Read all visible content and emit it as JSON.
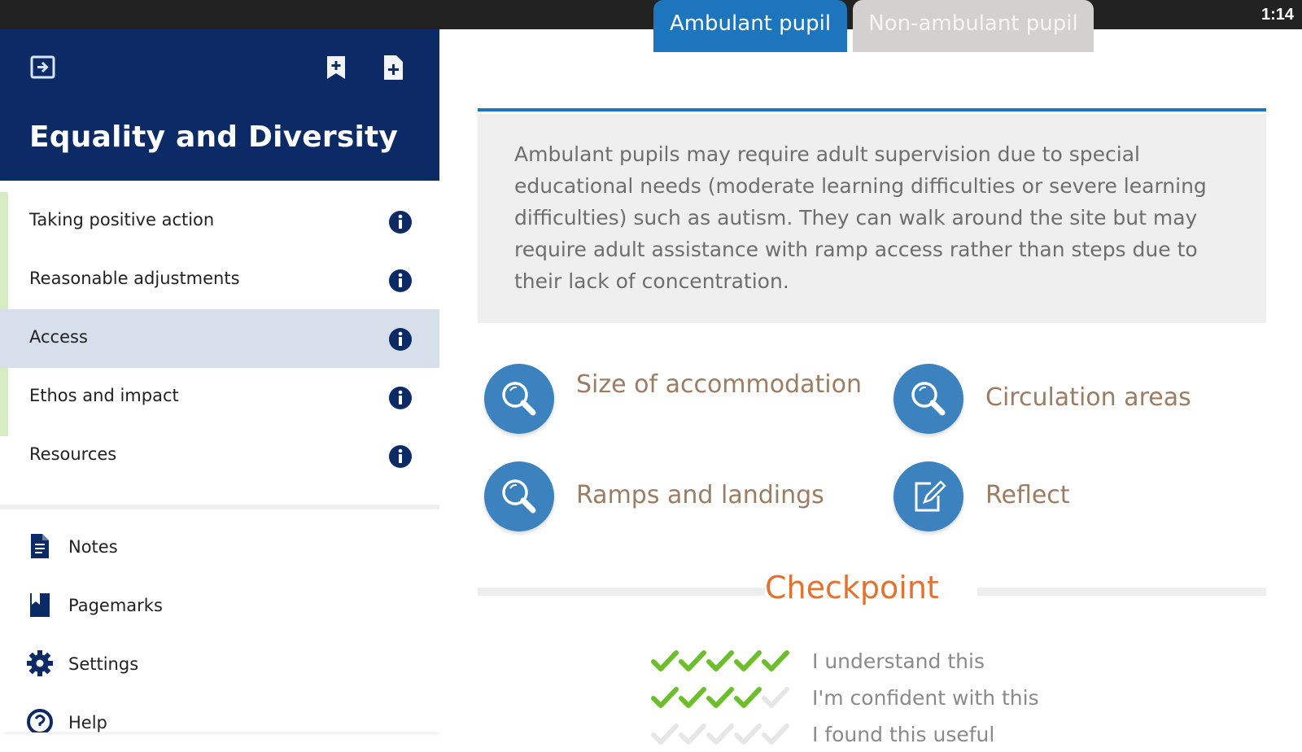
{
  "status_bar": {
    "time": "1:14"
  },
  "sidebar": {
    "title": "Equality and Diversity",
    "header_icons": [
      "exit-icon",
      "add-bookmark-icon",
      "add-note-icon"
    ],
    "menu_items": [
      {
        "label": "Taking positive action",
        "active": false
      },
      {
        "label": "Reasonable adjustments",
        "active": false
      },
      {
        "label": "Access",
        "active": true
      },
      {
        "label": "Ethos and impact",
        "active": false
      },
      {
        "label": "Resources",
        "active": false
      }
    ],
    "nav_items": [
      {
        "label": "Notes",
        "icon": "notes-icon"
      },
      {
        "label": "Pagemarks",
        "icon": "pagemarks-icon"
      },
      {
        "label": "Settings",
        "icon": "gear-icon"
      },
      {
        "label": "Help",
        "icon": "help-icon"
      }
    ]
  },
  "main": {
    "tabs": [
      {
        "label": "Ambulant pupil",
        "active": true
      },
      {
        "label": "Non-ambulant pupil",
        "active": false
      }
    ],
    "description": "Ambulant pupils may require adult supervision due to special educational needs (moderate learning difficulties or severe learning difficulties) such as autism. They can walk around the site but may require adult assistance with ramp access rather than steps due to their lack of concentration.",
    "topics": [
      {
        "label": "Size of accommodation",
        "icon": "magnifier-icon"
      },
      {
        "label": "Circulation areas",
        "icon": "magnifier-icon"
      },
      {
        "label": "Ramps and landings",
        "icon": "magnifier-icon"
      },
      {
        "label": "Reflect",
        "icon": "reflect-edit-icon"
      }
    ],
    "checkpoint": {
      "title": "Checkpoint",
      "rows": [
        {
          "label": "I understand this",
          "rating": 5,
          "max": 5
        },
        {
          "label": "I'm confident with this",
          "rating": 4,
          "max": 5
        },
        {
          "label": "I found this useful",
          "rating": 0,
          "max": 5
        }
      ]
    }
  },
  "colors": {
    "header_navy": "#0c2a66",
    "tab_blue": "#1d75bd",
    "topic_circle": "#3b82bf",
    "topic_text": "#9a7d63",
    "checkpoint_orange": "#e3712f",
    "tick_green": "#6cbf2a",
    "active_row": "#d7e0ea"
  }
}
